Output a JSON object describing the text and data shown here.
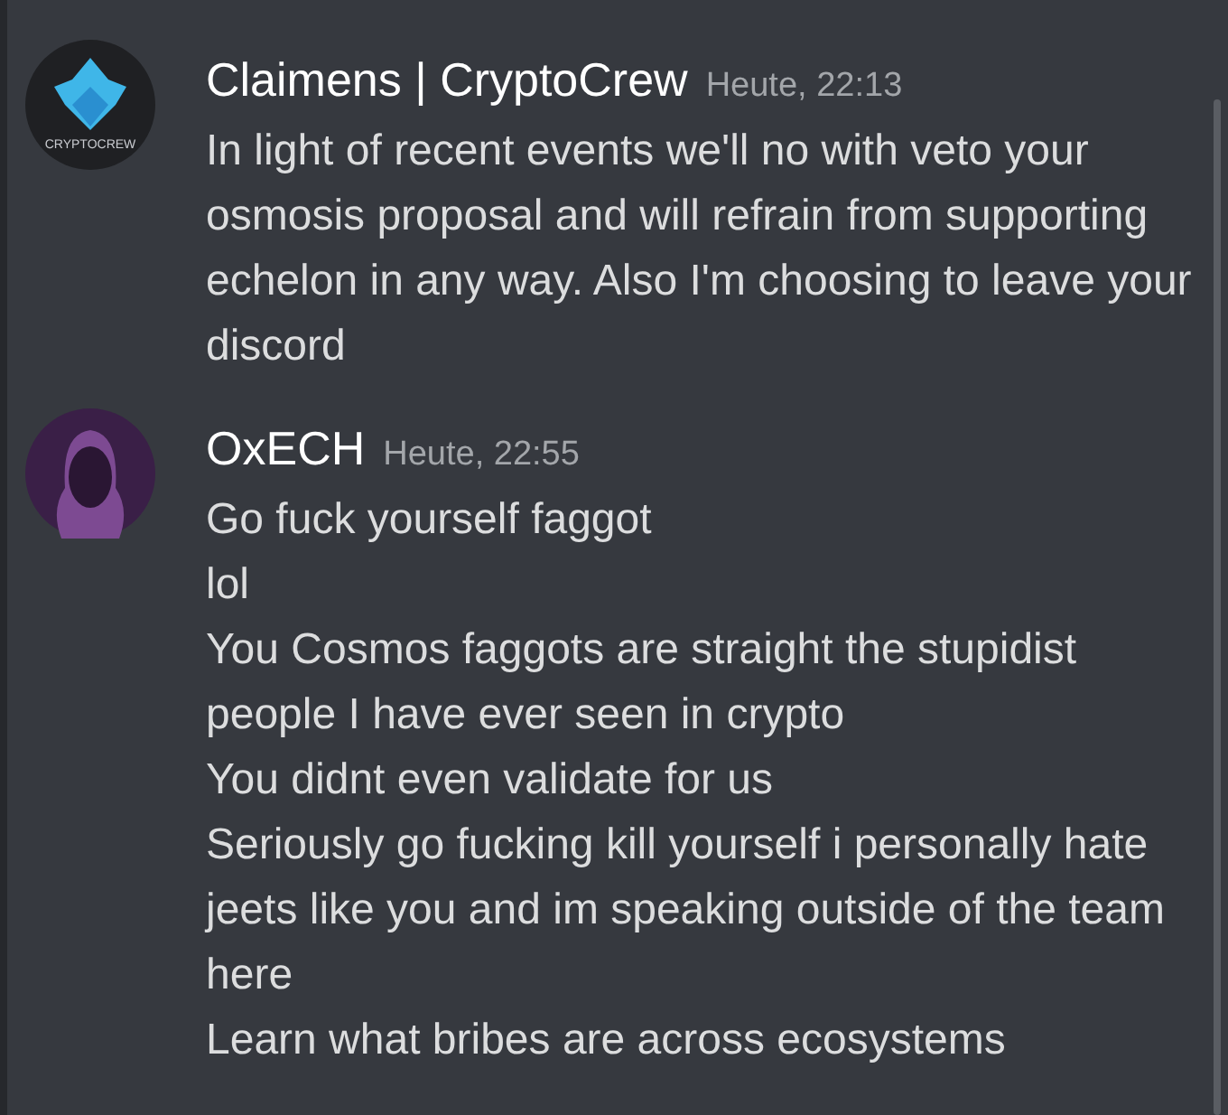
{
  "messages": [
    {
      "author": "Claimens | CryptoCrew",
      "time": "Heute, 22:13",
      "avatar": {
        "kind": "logo",
        "text": "CRYPTOCREW"
      },
      "lines": [
        "In light of recent events we'll no with veto your osmosis proposal and will refrain from supporting echelon in any way. Also I'm choosing to leave your discord"
      ]
    },
    {
      "author": "OxECH",
      "time": "Heute, 22:55",
      "avatar": {
        "kind": "hood"
      },
      "lines": [
        "Go fuck yourself faggot",
        "lol",
        "You Cosmos faggots are straight the stupidist people I have ever seen in crypto",
        "You didnt even validate for us",
        "Seriously go fucking kill yourself i personally hate jeets like you and im speaking outside of the team here",
        "Learn what bribes are across ecosystems"
      ]
    }
  ]
}
